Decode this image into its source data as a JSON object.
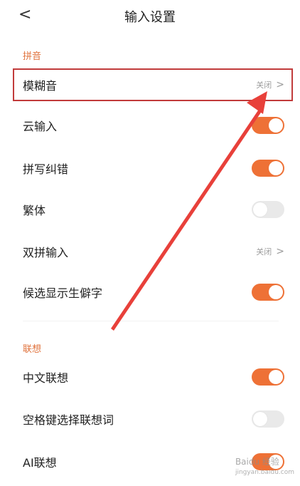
{
  "header": {
    "back_label": "<",
    "title": "输入设置"
  },
  "sections": [
    {
      "label": "拼音",
      "items": [
        {
          "label": "模糊音",
          "type": "link",
          "value": "关闭",
          "chevron": ">"
        },
        {
          "label": "云输入",
          "type": "toggle",
          "enabled": true
        },
        {
          "label": "拼写纠错",
          "type": "toggle",
          "enabled": true
        },
        {
          "label": "繁体",
          "type": "toggle",
          "enabled": false
        },
        {
          "label": "双拼输入",
          "type": "link",
          "value": "关闭",
          "chevron": ">"
        },
        {
          "label": "候选显示生僻字",
          "type": "toggle",
          "enabled": true
        }
      ]
    },
    {
      "label": "联想",
      "items": [
        {
          "label": "中文联想",
          "type": "toggle",
          "enabled": true
        },
        {
          "label": "空格键选择联想词",
          "type": "toggle",
          "enabled": false
        },
        {
          "label": "AI联想",
          "type": "toggle",
          "enabled": true
        }
      ]
    }
  ],
  "watermark": {
    "text": "Baidu 经验",
    "sub": "jingyan.baidu.com"
  },
  "colors": {
    "accent": "#ee7136",
    "section_label": "#e0733d",
    "highlight_border": "#c13b3b",
    "arrow": "#e8403a"
  }
}
